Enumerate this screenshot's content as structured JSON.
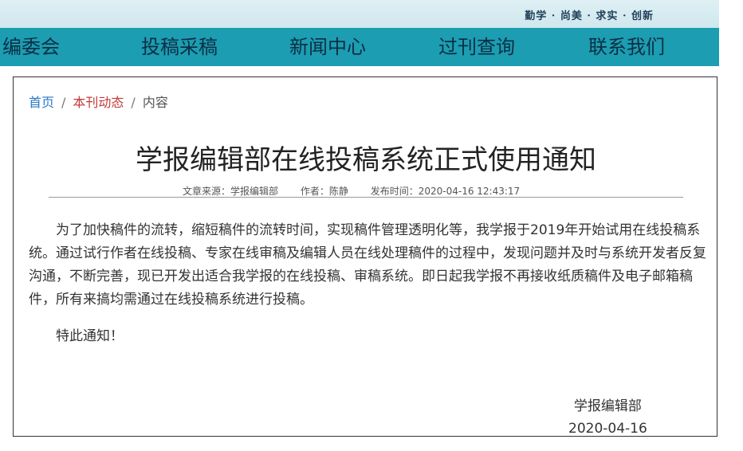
{
  "header": {
    "motto": "勤学 · 尚美 · 求实 · 创新"
  },
  "nav": {
    "items": [
      {
        "label": "编委会"
      },
      {
        "label": "投稿采稿"
      },
      {
        "label": "新闻中心"
      },
      {
        "label": "过刊查询"
      },
      {
        "label": "联系我们"
      }
    ]
  },
  "breadcrumb": {
    "home": "首页",
    "section": "本刊动态",
    "current": "内容",
    "separator": "/"
  },
  "article": {
    "title": "学报编辑部在线投稿系统正式使用通知",
    "meta": {
      "source_label": "文章来源：",
      "source": "学报编辑部",
      "author_label": "作者：",
      "author": "陈静",
      "date_label": "发布时间：",
      "date": "2020-04-16 12:43:17"
    },
    "paragraphs": [
      "为了加快稿件的流转，缩短稿件的流转时间，实现稿件管理透明化等，我学报于2019年开始试用在线投稿系统。通过试行作者在线投稿、专家在线审稿及编辑人员在线处理稿件的过程中，发现问题并及时与系统开发者反复沟通，不断完善，现已开发出适合我学报的在线投稿、审稿系统。即日起我学报不再接收纸质稿件及电子邮箱稿件，所有来搞均需通过在线投稿系统进行投稿。",
      "特此通知！"
    ],
    "signature": {
      "org": "学报编辑部",
      "date": "2020-04-16"
    }
  },
  "colors": {
    "nav_bg": "#1c9db1",
    "nav_text": "#0c2e45",
    "banner_bg": "#dff0f4",
    "breadcrumb_home": "#2a78c8",
    "breadcrumb_section": "#c23b3b"
  }
}
